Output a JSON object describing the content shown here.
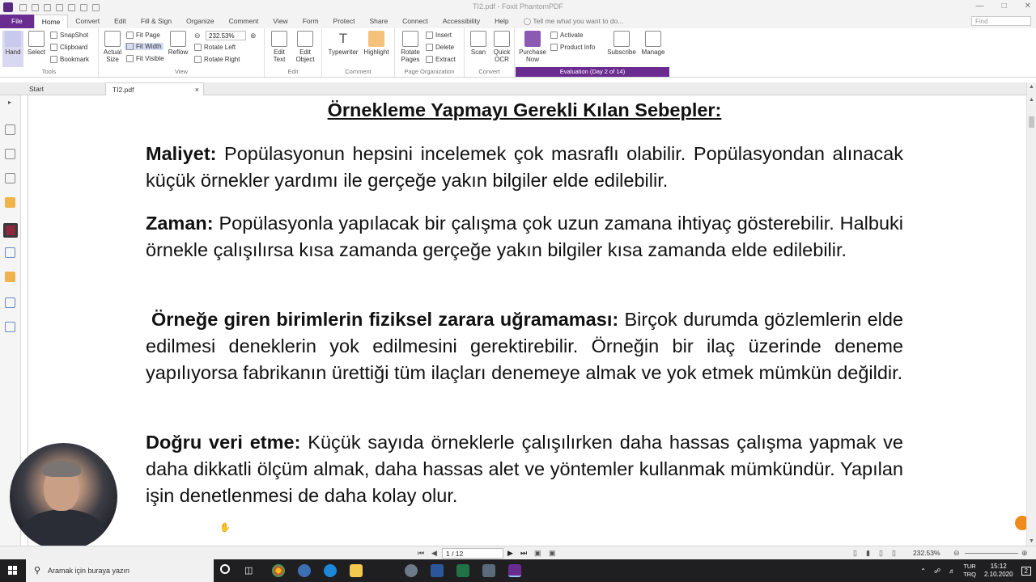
{
  "window": {
    "title": "TI2.pdf - Foxit PhantomPDF"
  },
  "ribbon_tabs": [
    "File",
    "Home",
    "Convert",
    "Edit",
    "Fill & Sign",
    "Organize",
    "Comment",
    "View",
    "Form",
    "Protect",
    "Share",
    "Connect",
    "Accessibility",
    "Help"
  ],
  "tell_me": "Tell me what you want to do...",
  "find_placeholder": "Find",
  "ribbon": {
    "tools": {
      "hand": "Hand",
      "select": "Select",
      "snapshot": "SnapShot",
      "clipboard": "Clipboard",
      "bookmark": "Bookmark",
      "label": "Tools"
    },
    "view": {
      "actual_size": "Actual Size",
      "fit_page": "Fit Page",
      "fit_width": "Fit Width",
      "fit_visible": "Fit Visible",
      "reflow": "Reflow",
      "zoom": "232.53%",
      "rotate_left": "Rotate Left",
      "rotate_right": "Rotate Right",
      "label": "View"
    },
    "edit": {
      "edit_text": "Edit Text",
      "edit_object": "Edit Object",
      "label": "Edit"
    },
    "comment": {
      "typewriter": "Typewriter",
      "highlight": "Highlight",
      "label": "Comment"
    },
    "page_org": {
      "rotate_pages": "Rotate Pages",
      "insert": "Insert",
      "delete": "Delete",
      "extract": "Extract",
      "label": "Page Organization"
    },
    "convert": {
      "scan": "Scan",
      "quick_ocr": "Quick OCR",
      "label": "Convert"
    },
    "purchase": {
      "purchase_now": "Purchase Now",
      "activate": "Activate",
      "product_info": "Product Info",
      "subscribe": "Subscribe",
      "manage": "Manage"
    },
    "evaluation": "Evaluation (Day 2 of 14)"
  },
  "doc_tabs": {
    "start": "Start",
    "file": "TI2.pdf"
  },
  "document": {
    "title": "Örnekleme Yapmayı Gerekli Kılan Sebepler:",
    "paragraphs": [
      {
        "head": "Maliyet:",
        "body": " Popülasyonun hepsini incelemek çok masraflı olabilir. Popülasyondan alınacak küçük örnekler yardımı ile gerçeğe yakın bilgiler elde edilebilir."
      },
      {
        "head": "Zaman:",
        "body": " Popülasyonla yapılacak bir çalışma çok uzun zamana ihtiyaç gösterebilir. Halbuki örnekle çalışılırsa kısa zamanda gerçeğe yakın bilgiler kısa zamanda elde edilebilir."
      },
      {
        "head": "Örneğe giren birimlerin fiziksel zarara uğramaması:",
        "body": " Birçok durumda gözlemlerin elde edilmesi deneklerin yok edilmesini gerektirebilir. Örneğin bir ilaç üzerinde deneme yapılıyorsa fabrikanın ürettiği tüm ilaçları denemeye almak ve yok etmek mümkün değildir."
      },
      {
        "head": "Doğru veri etme:",
        "body": " Küçük sayıda örneklerle çalışılırken daha hassas çalışma yapmak ve daha dikkatli ölçüm almak, daha hassas alet ve yöntemler kullanmak mümkündür. Yapılan işin denetlenmesi de daha kolay olur."
      }
    ]
  },
  "status": {
    "page": "1 / 12",
    "zoom": "232.53%"
  },
  "taskbar": {
    "search": "Aramak için buraya yazın",
    "lang_top": "TUR",
    "lang_bottom": "TRQ",
    "time": "15:12",
    "date": "2.10.2020",
    "notifications": "2"
  },
  "colors": {
    "accent": "#6a2c91",
    "orange": "#f08a1c"
  }
}
